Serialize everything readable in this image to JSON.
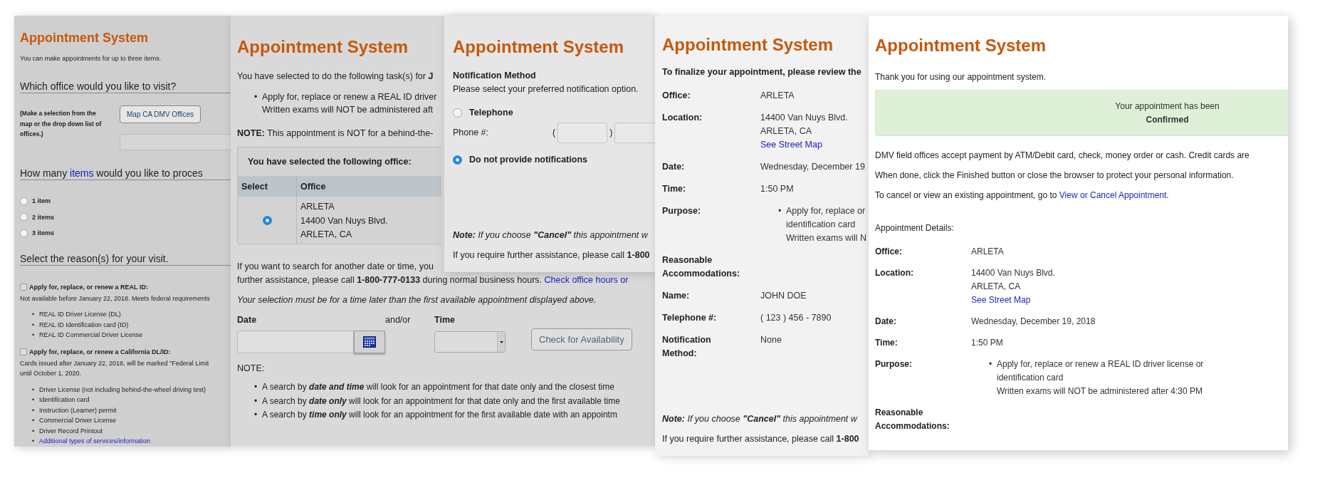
{
  "screens": [
    {
      "kind": "items",
      "bullet": "•",
      "title": "Appointment System",
      "intro": "You can make appointments for up to three items.",
      "office_heading": "Which office would you like to visit?",
      "office_hint": "(Make a selection from the map or the drop down list of offices.)",
      "map_button": "Map CA DMV Offices",
      "count_heading": {
        "before": "How many ",
        "link": "items",
        "after": " would you like to proces"
      },
      "count_options": [
        {
          "label": "1 item",
          "selected": false
        },
        {
          "label": "2 items",
          "selected": false
        },
        {
          "label": "3 items",
          "selected": false
        }
      ],
      "reasons_heading": "Select the reason(s) for your visit.",
      "reasons": [
        {
          "label": "Apply for, replace, or renew a REAL ID:",
          "checked": false,
          "note": [
            "Not available before January 22, 2018. Meets federal requirements"
          ],
          "items": [
            {
              "text": "REAL ID Driver License (DL)",
              "link": false
            },
            {
              "text": "REAL ID Identification card (ID)",
              "link": false
            },
            {
              "text": "REAL ID Commercial Driver License",
              "link": false
            }
          ]
        },
        {
          "label": "Apply for, replace, or renew a California DL/ID:",
          "checked": false,
          "note": [
            "Cards issued after January 22, 2018, will be marked \"Federal Limit",
            "until October 1, 2020."
          ],
          "items": [
            {
              "text": "Driver License (not including behind-the-wheel driving test)",
              "link": false
            },
            {
              "text": "Identification card",
              "link": false
            },
            {
              "text": "Instruction (Learner) permit",
              "link": false
            },
            {
              "text": "Commercial Driver License",
              "link": false
            },
            {
              "text": "Driver Record Printout",
              "link": false
            },
            {
              "text": "Additional types of services/information",
              "link": true
            }
          ]
        }
      ]
    },
    {
      "kind": "search",
      "bullet": "•",
      "title": "Appointment System",
      "intro": "You have selected to do the following task(s) for **J**",
      "tasks": [
        [
          "Apply for, replace or renew a REAL ID driver",
          "Written exams will NOT be administered aft"
        ]
      ],
      "note": "**NOTE:** This appointment is NOT for a behind-the-",
      "office_card": {
        "heading": "You have selected the following office:",
        "columns": [
          "Select",
          "Office"
        ],
        "rows": [
          {
            "selected": true,
            "lines": [
              "ARLETA",
              "14400 Van Nuys Blvd.",
              "ARLETA, CA"
            ]
          }
        ]
      },
      "search_help": {
        "lines": [
          "If you want to search for another date or time, you",
          "further assistance, please call **1-800-777-0133** during normal business hours. "
        ],
        "link": "Check office hours or"
      },
      "selection_rule": "Your selection must be for a time later than the first available appointment displayed above.",
      "date_label": "Date",
      "and_or": "and/or",
      "time_label": "Time",
      "check_button": "Check for Availability",
      "notes_label": "NOTE:",
      "search_notes": [
        "A search by **date and time** will look for an appointment for that date only and the closest time",
        "A search by **date only** will look for an appointment for that date only and the first available time",
        "A search by **time only** will look for an appointment for the first available date with an appointm"
      ]
    },
    {
      "kind": "notification",
      "title": "Appointment System",
      "heading": "Notification Method",
      "prompt": "Please select your preferred notification option.",
      "options": [
        {
          "kind": "phone",
          "label": "Telephone",
          "selected": false,
          "phone_label": "Phone #:",
          "open": "(",
          "close": ")"
        },
        {
          "kind": "plain",
          "label": "Do not provide notifications",
          "selected": true
        }
      ],
      "note": "**Note:** If you choose **\"Cancel\"** this appointment w",
      "assistance": "If you require further assistance, please call **1-800**"
    },
    {
      "kind": "review",
      "bullet": "•",
      "title": "Appointment System",
      "intro": "To finalize your appointment, please review the",
      "details": [
        {
          "kind": "text",
          "label": "Office:",
          "lines": [
            "ARLETA"
          ]
        },
        {
          "kind": "address",
          "label": "Location:",
          "lines": [
            "14400 Van Nuys Blvd.",
            "ARLETA, CA"
          ],
          "link": "See Street Map"
        },
        {
          "kind": "text",
          "label": "Date:",
          "lines": [
            "Wednesday, December 19"
          ]
        },
        {
          "kind": "text",
          "label": "Time:",
          "lines": [
            "1:50 PM"
          ]
        },
        {
          "kind": "list",
          "label": "Purpose:",
          "lines": [
            "Apply for, replace or",
            "identification card",
            "Written exams will N"
          ]
        },
        {
          "kind": "text",
          "label": "Reasonable Accommodations:"
        },
        {
          "kind": "text",
          "label": "Name:",
          "lines": [
            "JOHN DOE"
          ]
        },
        {
          "kind": "text",
          "label": "Telephone #:",
          "lines": [
            "( 123 ) 456 - 7890"
          ]
        },
        {
          "kind": "text",
          "label": "Notification Method:",
          "lines": [
            "None"
          ]
        }
      ],
      "note": "**Note:** If you choose **\"Cancel\"** this appointment w",
      "assistance": "If you require further assistance, please call **1-800**"
    },
    {
      "kind": "confirmation",
      "bullet": "•",
      "title": "Appointment System",
      "intro": "Thank you for using our appointment system.",
      "banner": {
        "message": "Your appointment has been",
        "status": "Confirmed"
      },
      "paragraphs": [
        "DMV field offices accept payment by ATM/Debit card, check, money order or cash. Credit cards are",
        "When done, click the Finished button or close the browser to protect your personal information."
      ],
      "cancel_text": {
        "before": "To cancel or view an existing appointment, go to ",
        "link": "View or Cancel Appointment."
      },
      "details_heading": "Appointment Details:",
      "details": [
        {
          "kind": "text",
          "label": "Office:",
          "lines": [
            "ARLETA"
          ]
        },
        {
          "kind": "address",
          "label": "Location:",
          "lines": [
            "14400 Van Nuys Blvd.",
            "ARLETA, CA"
          ],
          "link": "See Street Map"
        },
        {
          "kind": "text",
          "label": "Date:",
          "lines": [
            "Wednesday, December 19, 2018"
          ]
        },
        {
          "kind": "text",
          "label": "Time:",
          "lines": [
            "1:50 PM"
          ]
        },
        {
          "kind": "list",
          "label": "Purpose:",
          "lines": [
            "Apply for, replace or renew a REAL ID driver license or identification card",
            "Written exams will NOT be administered after 4:30 PM"
          ]
        },
        {
          "kind": "text",
          "label": "Reasonable Accommodations:"
        }
      ]
    }
  ]
}
